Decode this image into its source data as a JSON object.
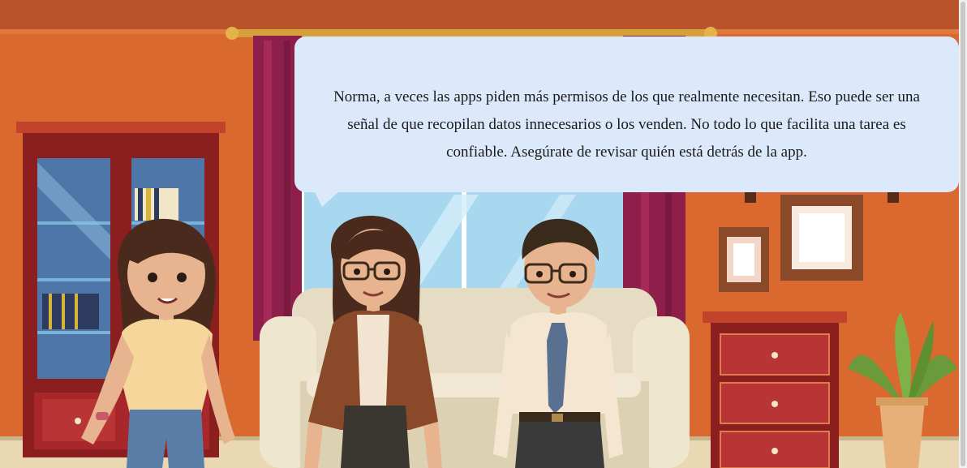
{
  "scene": {
    "type": "visual-novel-dialogue",
    "setting": "living-room",
    "characters": [
      "girl",
      "woman",
      "man"
    ]
  },
  "dialogue": {
    "text": "Norma, a veces las apps piden más permisos de los que realmente necesitan. Eso puede ser una señal de que recopilan datos innecesarios o los venden. No todo lo que facilita una tarea es confiable. Asegúrate de revisar quién está detrás de la app."
  },
  "colors": {
    "wall": "#d9692f",
    "bubble": "#dce9fb",
    "curtain": "#8e1f4a",
    "sofa": "#e6dcc3",
    "cabinet": "#8b1e1e"
  }
}
